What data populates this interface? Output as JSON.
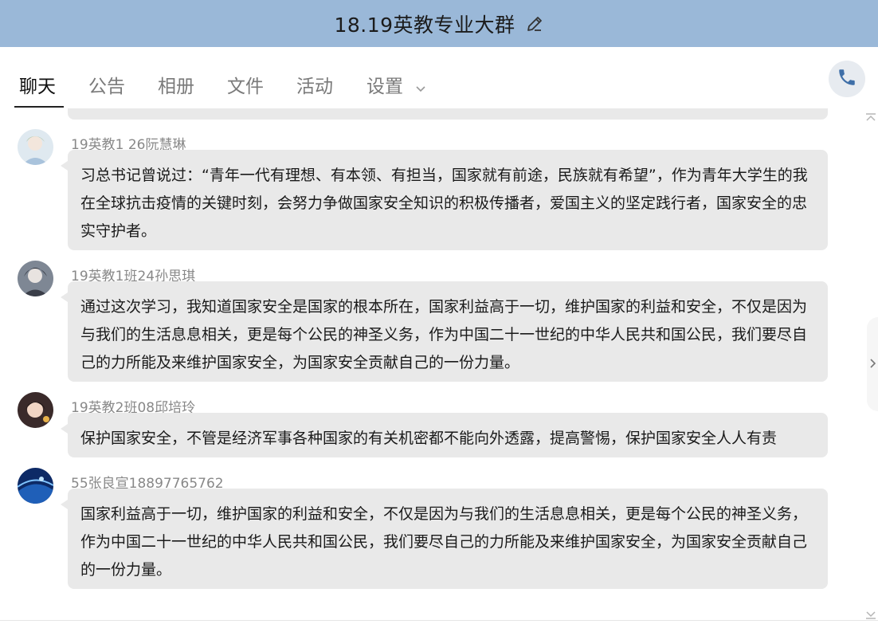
{
  "window": {
    "title": "18.19英教专业大群"
  },
  "tabs": [
    {
      "label": "聊天",
      "active": true
    },
    {
      "label": "公告",
      "active": false
    },
    {
      "label": "相册",
      "active": false
    },
    {
      "label": "文件",
      "active": false
    },
    {
      "label": "活动",
      "active": false
    },
    {
      "label": "设置",
      "active": false
    }
  ],
  "icons": {
    "edit": "pencil-icon",
    "call": "phone-icon",
    "settings_menu": "chevron-down-icon",
    "scroll_up": "chevron-up-icon",
    "scroll_down": "chevron-down-icon",
    "side_panel": "chevron-right-icon"
  },
  "colors": {
    "titlebar": "#9ab8d8",
    "bubble": "#e9e9e9",
    "call_icon": "#3f6fa8"
  },
  "messages": [
    {
      "sender": "19英教1 26阮慧琳",
      "text": "习总书记曾说过：“青年一代有理想、有本领、有担当，国家就有前途，民族就有希望”，作为青年大学生的我在全球抗击疫情的关键时刻，会努力争做国家安全知识的积极传播者，爱国主义的坚定践行者，国家安全的忠实守护者。"
    },
    {
      "sender": "19英教1班24孙思琪",
      "text": "通过这次学习，我知道国家安全是国家的根本所在，国家利益高于一切，维护国家的利益和安全，不仅是因为与我们的生活息息相关，更是每个公民的神圣义务，作为中国二十一世纪的中华人民共和国公民，我们要尽自己的力所能及来维护国家安全，为国家安全贡献自己的一份力量。"
    },
    {
      "sender": "19英教2班08邱培玲",
      "text": "保护国家安全，不管是经济军事各种国家的有关机密都不能向外透露，提高警惕，保护国家安全人人有责"
    },
    {
      "sender": "55张良宣18897765762",
      "text": "国家利益高于一切，维护国家的利益和安全，不仅是因为与我们的生活息息相关，更是每个公民的神圣义务，作为中国二十一世纪的中华人民共和国公民，我们要尽自己的力所能及来维护国家安全，为国家安全贡献自己的一份力量。"
    }
  ]
}
